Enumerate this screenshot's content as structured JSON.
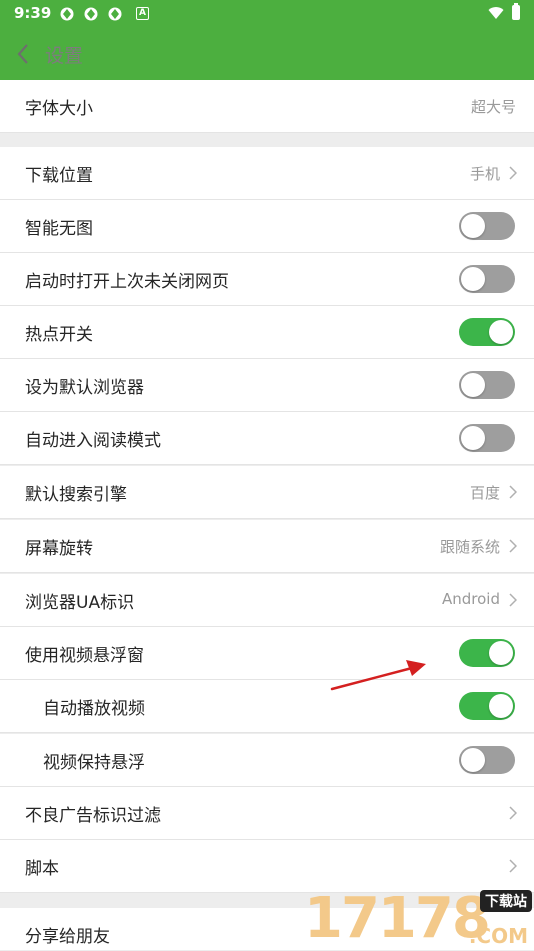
{
  "status_bar": {
    "time": "9:39",
    "a_icon_letter": "A"
  },
  "header": {
    "title": "设置"
  },
  "settings": {
    "font_size": {
      "label": "字体大小",
      "value": "超大号"
    },
    "download_location": {
      "label": "下载位置",
      "value": "手机"
    },
    "smart_no_image": {
      "label": "智能无图",
      "on": false
    },
    "restore_tabs": {
      "label": "启动时打开上次未关闭网页",
      "on": false
    },
    "hotspot": {
      "label": "热点开关",
      "on": true
    },
    "default_browser": {
      "label": "设为默认浏览器",
      "on": false
    },
    "reading_mode": {
      "label": "自动进入阅读模式",
      "on": false
    },
    "search_engine": {
      "label": "默认搜索引擎",
      "value": "百度"
    },
    "screen_rotation": {
      "label": "屏幕旋转",
      "value": "跟随系统"
    },
    "ua": {
      "label": "浏览器UA标识",
      "value": "Android"
    },
    "video_float": {
      "label": "使用视频悬浮窗",
      "on": true
    },
    "autoplay_video": {
      "label": "自动播放视频",
      "on": true
    },
    "video_keep_float": {
      "label": "视频保持悬浮",
      "on": false
    },
    "ad_filter": {
      "label": "不良广告标识过滤"
    },
    "scripts": {
      "label": "脚本"
    },
    "share": {
      "label": "分享给朋友"
    }
  },
  "watermark": {
    "digits": "17178",
    "tag": "下载站",
    "domain": ".COM"
  },
  "colors": {
    "brand_green": "#4caf3f",
    "toggle_on": "#3cb54a",
    "toggle_off": "#9e9e9e",
    "annotation_arrow": "#d42020"
  }
}
